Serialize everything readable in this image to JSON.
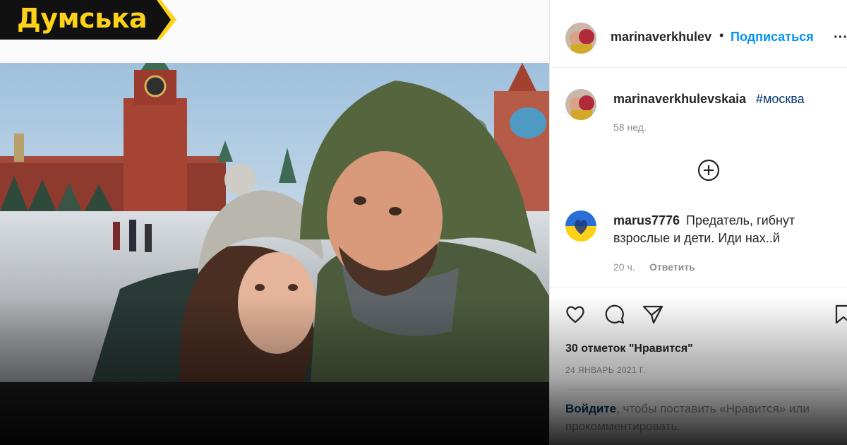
{
  "brand": {
    "logo_text": "Думська",
    "color": "#ffd21a",
    "background": "#111111"
  },
  "header": {
    "username": "marinaverkhulev",
    "separator": "•",
    "follow_label": "Подписаться",
    "more_icon": "more-horizontal-icon"
  },
  "caption": {
    "username": "marinaverkhulevskaia",
    "hashtag": "#москва",
    "time": "58 нед."
  },
  "load_more_icon": "plus-circle-icon",
  "comment": {
    "username": "marus7776",
    "text_line1": "Предатель, гибнут",
    "text_line2": "взрослые и дети. Иди нах..й",
    "time": "20 ч.",
    "reply_label": "Ответить"
  },
  "actions": {
    "likes": "30 отметок \"Нравится\"",
    "date": "24 ЯНВАРЬ 2021 Г.",
    "login_link": "Войдите",
    "login_text": ", чтобы поставить «Нравится» или прокомментировать."
  },
  "colors": {
    "link_blue": "#0095f6",
    "hashtag_blue": "#00376b",
    "muted": "#8e8e8e"
  }
}
